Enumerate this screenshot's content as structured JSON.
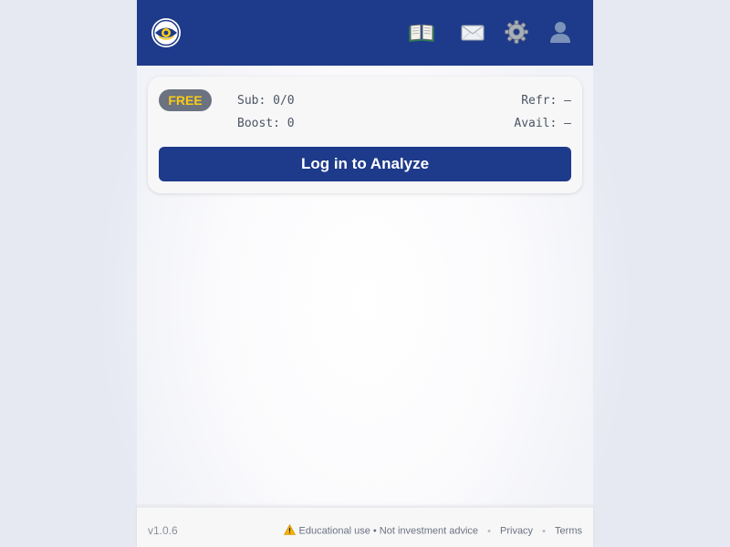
{
  "header": {
    "logo_icon": "eye-logo-icon",
    "nav_icons": [
      "book-icon",
      "mail-icon",
      "gear-icon",
      "user-icon"
    ],
    "background_color": "#1e3a8a"
  },
  "status_card": {
    "plan_badge": "FREE",
    "subscription": "Sub: 0/0",
    "boost": "Boost: 0",
    "refresh": "Refr: —",
    "available": "Avail: —",
    "login_button": "Log in to Analyze",
    "badge_text_color": "#facc15",
    "button_color": "#1e3a8a"
  },
  "footer": {
    "version": "v1.0.6",
    "warning_icon": "warning-icon",
    "disclaimer": "Educational use • Not investment advice",
    "separator": "•",
    "privacy_link": "Privacy",
    "terms_link": "Terms"
  }
}
